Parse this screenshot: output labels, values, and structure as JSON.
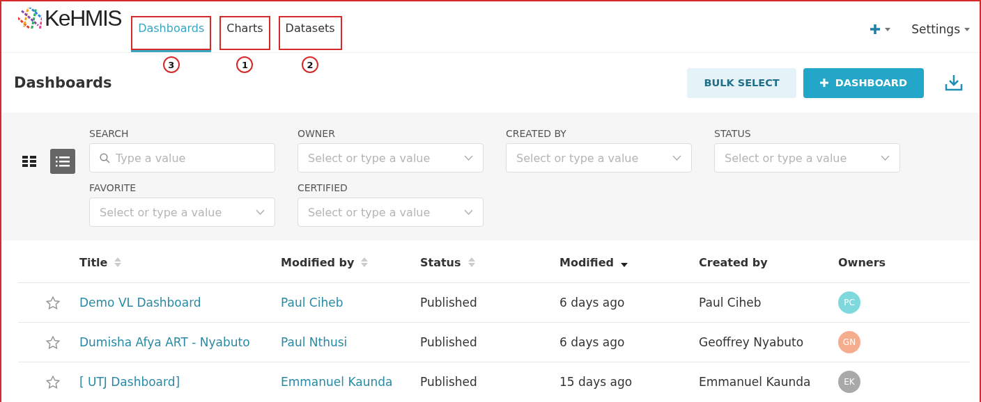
{
  "brand": {
    "name": "KeHMIS"
  },
  "tabs": [
    {
      "label": "Dashboards",
      "selected": true,
      "callout": "3"
    },
    {
      "label": "Charts",
      "selected": false,
      "callout": "1"
    },
    {
      "label": "Datasets",
      "selected": false,
      "callout": "2"
    }
  ],
  "nav_right": {
    "settings": "Settings"
  },
  "page": {
    "title": "Dashboards",
    "buttons": [
      {
        "label": "BULK SELECT",
        "kind": "secondary"
      },
      {
        "label": "DASHBOARD",
        "kind": "primary"
      }
    ]
  },
  "view_toggle": [
    {
      "kind": "card",
      "selected": false
    },
    {
      "kind": "list",
      "selected": true
    }
  ],
  "filters": [
    [
      {
        "label": "SEARCH",
        "kind": "search",
        "placeholder": "Type a value"
      },
      {
        "label": "OWNER",
        "kind": "select",
        "placeholder": "Select or type a value"
      },
      {
        "label": "CREATED BY",
        "kind": "select",
        "placeholder": "Select or type a value"
      },
      {
        "label": "STATUS",
        "kind": "select",
        "placeholder": "Select or type a value"
      }
    ],
    [
      {
        "label": "FAVORITE",
        "kind": "select",
        "placeholder": "Select or type a value"
      },
      {
        "label": "CERTIFIED",
        "kind": "select",
        "placeholder": "Select or type a value"
      }
    ]
  ],
  "table": {
    "columns": [
      {
        "label": "Title",
        "sortable": true,
        "sorted": false
      },
      {
        "label": "Modified by",
        "sortable": true,
        "sorted": false
      },
      {
        "label": "Status",
        "sortable": true,
        "sorted": false
      },
      {
        "label": "Modified",
        "sortable": true,
        "sorted": true
      },
      {
        "label": "Created by",
        "sortable": false
      },
      {
        "label": "Owners",
        "sortable": false
      }
    ],
    "rows": [
      {
        "title": "Demo VL Dashboard",
        "modified_by": "Paul Ciheb",
        "status": "Published",
        "modified": "6 days ago",
        "created_by": "Paul Ciheb",
        "owner": {
          "initials": "PC",
          "color": "#7fd9dc"
        }
      },
      {
        "title": "Dumisha Afya ART - Nyabuto",
        "modified_by": "Paul Nthusi",
        "status": "Published",
        "modified": "6 days ago",
        "created_by": "Geoffrey Nyabuto",
        "owner": {
          "initials": "GN",
          "color": "#f6ad8e"
        }
      },
      {
        "title": "[ UTJ Dashboard]",
        "modified_by": "Emmanuel Kaunda",
        "status": "Published",
        "modified": "15 days ago",
        "created_by": "Emmanuel Kaunda",
        "owner": {
          "initials": "EK",
          "color": "#a9a9a9"
        }
      }
    ]
  }
}
